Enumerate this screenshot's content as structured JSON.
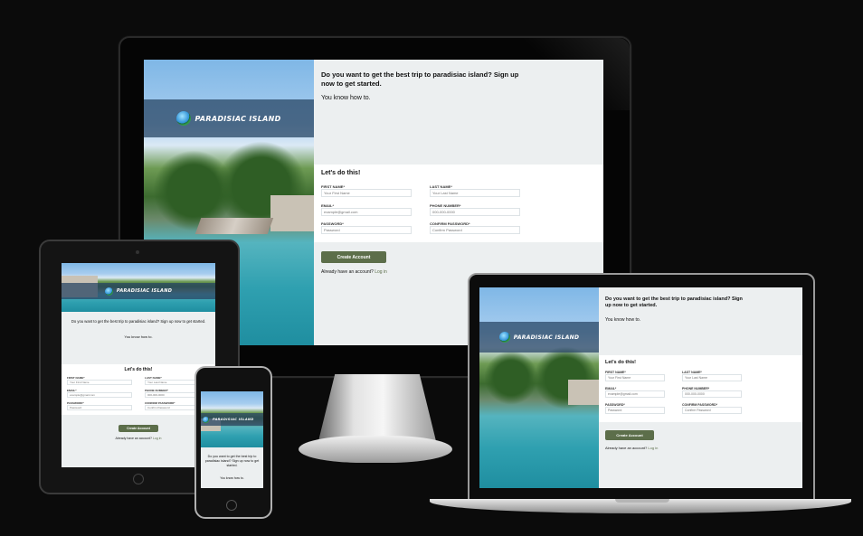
{
  "brand": {
    "name": "PARADISIAC ISLAND",
    "icon": "globe-icon"
  },
  "hero": {
    "headline": "Do you want to get the best trip to paradisiac island? Sign up now to get started.",
    "tagline": "You know how to."
  },
  "form": {
    "title": "Let's do this!",
    "first_name_label": "FIRST NAME*",
    "first_name_placeholder": "Your First Name",
    "last_name_label": "LAST NAME*",
    "last_name_placeholder": "Your Last Name",
    "email_label": "EMAIL*",
    "email_placeholder": "example@gmail.com",
    "phone_label": "PHONE NUMBER*",
    "phone_placeholder": "000-000-0000",
    "password_label": "PASSWORD*",
    "password_placeholder": "Password",
    "confirm_label": "CONFIRM PASSWORD*",
    "confirm_placeholder": "Confirm Password",
    "submit_label": "Create Account",
    "login_prefix": "Already have an account?",
    "login_link": "Log in"
  },
  "colors": {
    "accent": "#5c6e4a",
    "panel": "#eceff0",
    "background": "#0b0b0b"
  }
}
